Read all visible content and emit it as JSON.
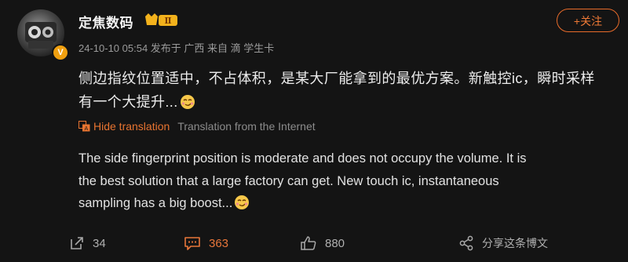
{
  "post": {
    "author_name": "定焦数码",
    "level_badge": "Ⅱ",
    "verified_mark": "V",
    "meta": "24-10-10 05:54 发布于 广西 来自 滴 学生卡",
    "follow_label": "+关注",
    "text_zh_line1": "侧边指纹位置适中，不占体积，是某大厂能拿到的最优方案。新触控ic，瞬时采样",
    "text_zh_line2": "有一个大提升...",
    "translation": {
      "hide_label": "Hide translation",
      "source_label": "Translation from the Internet",
      "text_en_line1": "The side fingerprint position is moderate and does not occupy the volume. It is",
      "text_en_line2": "the best solution that a large factory can get. New touch ic, instantaneous",
      "text_en_line3": "sampling has a big boost..."
    }
  },
  "actions": {
    "repost_count": "34",
    "comment_count": "363",
    "like_count": "880",
    "share_label": "分享这条博文"
  },
  "colors": {
    "accent": "#e8763a",
    "background": "#141414",
    "muted": "#9a9a9a"
  },
  "icons": {
    "repost": "repost-icon",
    "comment": "comment-icon",
    "like": "thumbs-up-icon",
    "share": "share-icon",
    "emoji": "smirk-emoji-icon",
    "translate": "translate-icon"
  }
}
